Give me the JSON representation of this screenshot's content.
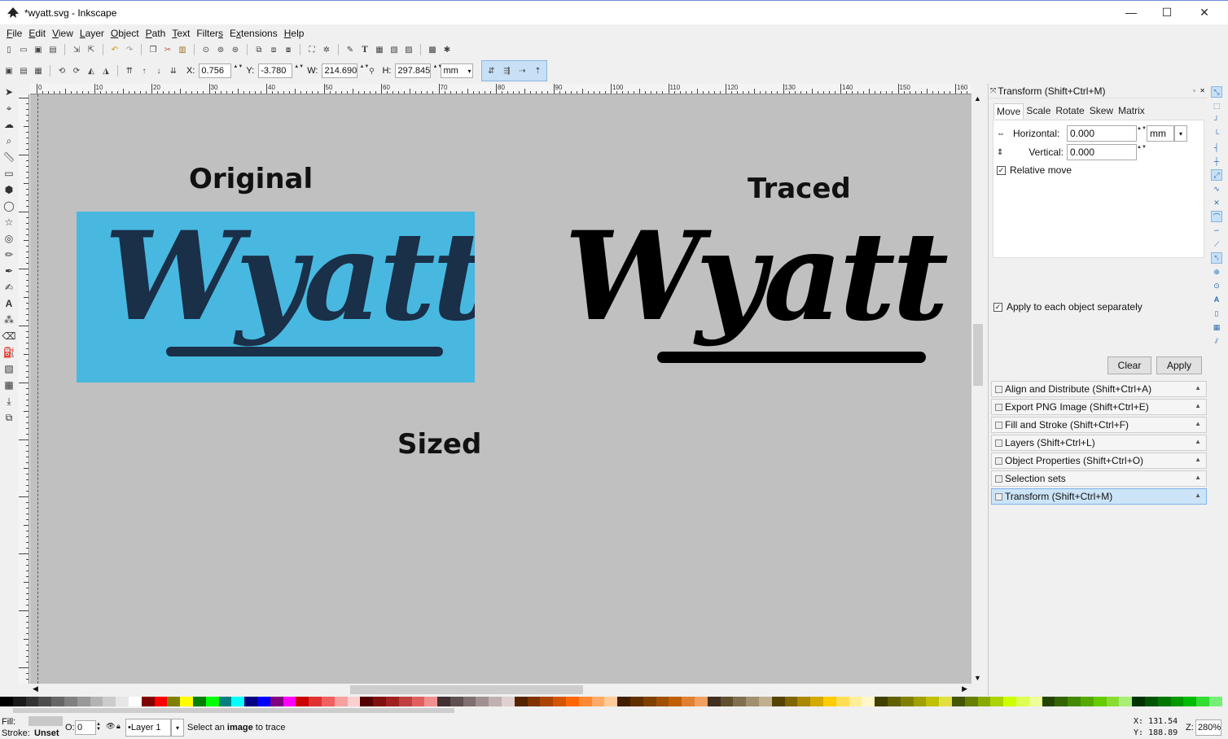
{
  "window": {
    "title": "*wyatt.svg - Inkscape",
    "minimize": "—",
    "maximize": "☐",
    "close": "✕"
  },
  "menu": [
    {
      "pre": "",
      "key": "F",
      "post": "ile"
    },
    {
      "pre": "",
      "key": "E",
      "post": "dit"
    },
    {
      "pre": "",
      "key": "V",
      "post": "iew"
    },
    {
      "pre": "",
      "key": "L",
      "post": "ayer"
    },
    {
      "pre": "",
      "key": "O",
      "post": "bject"
    },
    {
      "pre": "",
      "key": "P",
      "post": "ath"
    },
    {
      "pre": "",
      "key": "T",
      "post": "ext"
    },
    {
      "pre": "Filter",
      "key": "s",
      "post": ""
    },
    {
      "pre": "E",
      "key": "x",
      "post": "tensions"
    },
    {
      "pre": "",
      "key": "H",
      "post": "elp"
    }
  ],
  "selector_toolbar": {
    "x_label": "X:",
    "x_value": "0.756",
    "y_label": "Y:",
    "y_value": "-3.780",
    "w_label": "W:",
    "w_value": "214.690",
    "h_label": "H:",
    "h_value": "297.845",
    "unit": "mm"
  },
  "ruler_labels": [
    "0",
    "10",
    "20",
    "30",
    "40",
    "50",
    "60",
    "70",
    "80",
    "90",
    "100",
    "110",
    "120",
    "130",
    "140",
    "150",
    "160"
  ],
  "canvas": {
    "original_label": "Original",
    "traced_label": "Traced",
    "sized_label": "Sized",
    "logo_text": "Wyatt",
    "original_bg": "#48b8e0",
    "canvas_bg": "#c0c0c0"
  },
  "transform_panel": {
    "header": "Transform (Shift+Ctrl+M)",
    "tabs": [
      "Move",
      "Scale",
      "Rotate",
      "Skew",
      "Matrix"
    ],
    "active_tab": "Move",
    "horizontal_label": "Horizontal:",
    "horizontal_value": "0.000",
    "vertical_label": "Vertical:",
    "vertical_value": "0.000",
    "unit": "mm",
    "relative_move": "Relative move",
    "relative_move_checked": true,
    "apply_each": "Apply to each object separately",
    "apply_each_checked": true,
    "clear": "Clear",
    "apply": "Apply"
  },
  "dock_panels": [
    {
      "label": "Align and Distribute (Shift+Ctrl+A)",
      "active": false
    },
    {
      "label": "Export PNG Image (Shift+Ctrl+E)",
      "active": false
    },
    {
      "label": "Fill and Stroke (Shift+Ctrl+F)",
      "active": false
    },
    {
      "label": "Layers (Shift+Ctrl+L)",
      "active": false
    },
    {
      "label": "Object Properties (Shift+Ctrl+O)",
      "active": false
    },
    {
      "label": "Selection sets",
      "active": false
    },
    {
      "label": "Transform (Shift+Ctrl+M)",
      "active": true
    }
  ],
  "status": {
    "fill_label": "Fill:",
    "stroke_label": "Stroke:",
    "stroke_value": "Unset",
    "opacity_label": "O:",
    "opacity_value": "0",
    "layer": "•Layer 1",
    "message_pre": "Select an ",
    "message_bold": "image",
    "message_post": " to trace",
    "x_label": "X:",
    "x_value": "131.54",
    "y_label": "Y:",
    "y_value": "188.89",
    "z_label": "Z:",
    "z_value": "280%"
  },
  "palette": [
    "#000000",
    "#1a1a1a",
    "#333333",
    "#4d4d4d",
    "#666666",
    "#808080",
    "#999999",
    "#b3b3b3",
    "#cccccc",
    "#e6e6e6",
    "#ffffff",
    "#800000",
    "#ff0000",
    "#808000",
    "#ffff00",
    "#008000",
    "#00ff00",
    "#008080",
    "#00ffff",
    "#000080",
    "#0000ff",
    "#800080",
    "#ff00ff",
    "#cc0000",
    "#e03030",
    "#f06060",
    "#f8a0a0",
    "#fcd0d0",
    "#550000",
    "#801010",
    "#a02020",
    "#c04040",
    "#e06060",
    "#f09090",
    "#403030",
    "#605050",
    "#807070",
    "#a09090",
    "#c0b0b0",
    "#e0d0d0",
    "#552200",
    "#803300",
    "#aa4400",
    "#d45500",
    "#ff6600",
    "#ff8833",
    "#ffaa66",
    "#ffcc99",
    "#402000",
    "#603000",
    "#804000",
    "#a05000",
    "#c06000",
    "#e08030",
    "#f0a060",
    "#403020",
    "#605030",
    "#807050",
    "#a09070",
    "#c0b090",
    "#554400",
    "#806600",
    "#aa8800",
    "#d4aa00",
    "#ffcc00",
    "#ffdd55",
    "#ffee99",
    "#fff6cc",
    "#404000",
    "#606000",
    "#808000",
    "#a0a000",
    "#c0c000",
    "#e0e040",
    "#445500",
    "#668000",
    "#88aa00",
    "#aad400",
    "#ccff00",
    "#ddff55",
    "#eeff99",
    "#224400",
    "#336600",
    "#448800",
    "#55aa00",
    "#66cc00",
    "#88dd33",
    "#aaee77",
    "#003300",
    "#005500",
    "#007700",
    "#009900",
    "#00bb00",
    "#33dd33",
    "#77ee77"
  ]
}
